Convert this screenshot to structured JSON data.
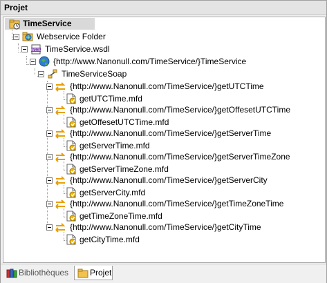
{
  "panel": {
    "title": "Projet"
  },
  "tree": {
    "root": "TimeService",
    "folder": "Webservice Folder",
    "wsdl": "TimeService.wsdl",
    "service": "{http://www.Nanonull.com/TimeService/}TimeService",
    "port": "TimeServiceSoap",
    "operations": [
      {
        "name": "{http://www.Nanonull.com/TimeService/}getUTCTime",
        "mapping": "getUTCTime.mfd"
      },
      {
        "name": "{http://www.Nanonull.com/TimeService/}getOffesetUTCTime",
        "mapping": "getOffesetUTCTime.mfd"
      },
      {
        "name": "{http://www.Nanonull.com/TimeService/}getServerTime",
        "mapping": "getServerTime.mfd"
      },
      {
        "name": "{http://www.Nanonull.com/TimeService/}getServerTimeZone",
        "mapping": "getServerTimeZone.mfd"
      },
      {
        "name": "{http://www.Nanonull.com/TimeService/}getServerCity",
        "mapping": "getServerCity.mfd"
      },
      {
        "name": "{http://www.Nanonull.com/TimeService/}getTimeZoneTime",
        "mapping": "getTimeZoneTime.mfd"
      },
      {
        "name": "{http://www.Nanonull.com/TimeService/}getCityTime",
        "mapping": "getCityTime.mfd"
      }
    ]
  },
  "tabs": [
    {
      "label": "Bibliothèques",
      "active": false
    },
    {
      "label": "Projet",
      "active": true
    }
  ],
  "colors": {
    "selection": "#d9d9d9",
    "folder": "#f2c14e",
    "arrow": "#e8a000"
  }
}
